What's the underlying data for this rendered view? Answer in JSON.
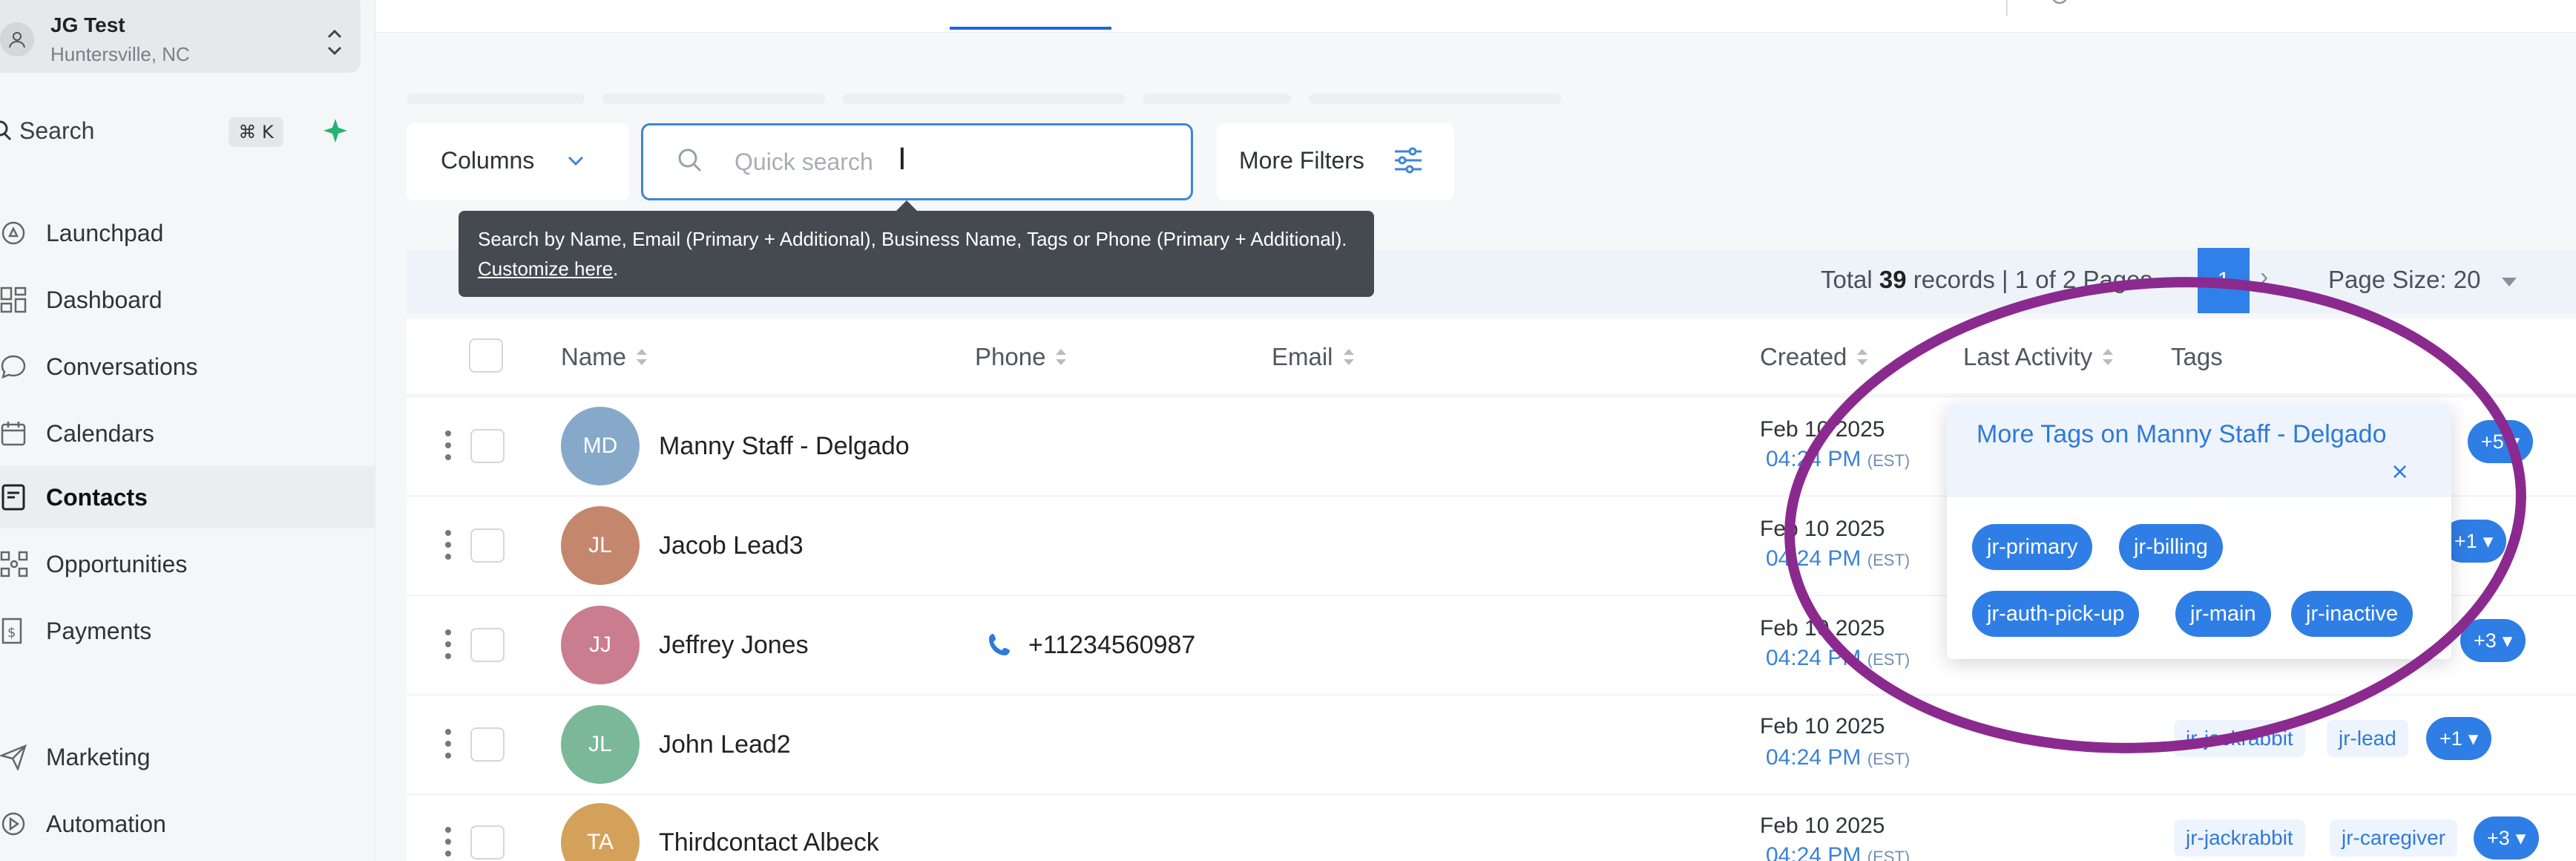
{
  "account": {
    "name": "JG Test",
    "location": "Huntersville, NC"
  },
  "sidebar": {
    "search_label": "Search",
    "search_shortcut": "⌘ K",
    "nav": [
      {
        "label": "Launchpad",
        "icon": "rocket-icon"
      },
      {
        "label": "Dashboard",
        "icon": "dashboard-icon"
      },
      {
        "label": "Conversations",
        "icon": "chat-icon"
      },
      {
        "label": "Calendars",
        "icon": "calendar-icon"
      },
      {
        "label": "Contacts",
        "icon": "contacts-icon",
        "active": true
      },
      {
        "label": "Opportunities",
        "icon": "opportunities-icon"
      },
      {
        "label": "Payments",
        "icon": "payments-icon"
      },
      {
        "label": "Marketing",
        "icon": "send-icon"
      },
      {
        "label": "Automation",
        "icon": "automation-icon"
      }
    ]
  },
  "toolbar": {
    "columns_label": "Columns",
    "search_placeholder": "Quick search",
    "more_filters_label": "More Filters"
  },
  "tooltip": {
    "text": "Search by Name, Email (Primary + Additional), Business Name, Tags or Phone (Primary + Additional).",
    "link": "Customize here"
  },
  "pagination": {
    "total_prefix": "Total",
    "total_count": "39",
    "total_suffix": "records | 1 of 2 Pages",
    "current_page": "1",
    "page_size": "Page Size: 20"
  },
  "table": {
    "headers": {
      "name": "Name",
      "phone": "Phone",
      "email": "Email",
      "created": "Created",
      "last_activity": "Last Activity",
      "tags": "Tags"
    },
    "rows": [
      {
        "initials": "MD",
        "name": "Manny Staff - Delgado",
        "phone": "",
        "date": "Feb 10 2025",
        "time": "04:24 PM",
        "tz": "(EST)",
        "tags": [],
        "more": "+5",
        "avatar_color": "#86a8c9"
      },
      {
        "initials": "JL",
        "name": "Jacob Lead3",
        "phone": "",
        "date": "Feb 10 2025",
        "time": "04:24 PM",
        "tz": "(EST)",
        "tags": [],
        "more": "+1",
        "avatar_color": "#c4866d"
      },
      {
        "initials": "JJ",
        "name": "Jeffrey Jones",
        "phone": "+11234560987",
        "date": "Feb 10 2025",
        "time": "04:24 PM",
        "tz": "(EST)",
        "tags": [],
        "more": "+3",
        "avatar_color": "#c97d8e"
      },
      {
        "initials": "JL",
        "name": "John Lead2",
        "phone": "",
        "date": "Feb 10 2025",
        "time": "04:24 PM",
        "tz": "(EST)",
        "tags": [
          "jr-jackrabbit",
          "jr-lead"
        ],
        "more": "+1",
        "avatar_color": "#7ab898"
      },
      {
        "initials": "TA",
        "name": "Thirdcontact Albeck",
        "phone": "",
        "date": "Feb 10 2025",
        "time": "04:24 PM",
        "tz": "(EST)",
        "tags": [
          "jr-jackrabbit",
          "jr-caregiver"
        ],
        "more": "+3",
        "avatar_color": "#d4a15a"
      }
    ]
  },
  "tags_popover": {
    "title": "More Tags on Manny Staff - Delgado",
    "close": "×",
    "tags": [
      "jr-primary",
      "jr-billing",
      "jr-auth-pick-up",
      "jr-main",
      "jr-inactive"
    ]
  },
  "colors": {
    "accent": "#2f7ee5",
    "annotation": "#8b2a8e",
    "tooltip_bg": "#454a50"
  }
}
